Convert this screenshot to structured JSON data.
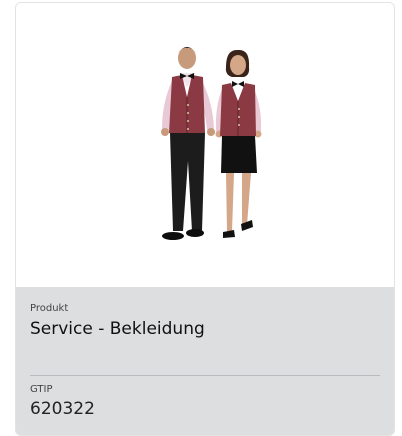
{
  "product": {
    "image_alt": "Service staff uniform: man and woman in burgundy vests",
    "category_label": "Produkt",
    "category_value": "Service - Bekleidung",
    "gtip_label": "GTIP",
    "gtip_value": "620322"
  },
  "colors": {
    "info_background": "#dddee0",
    "vest": "#8b3a44",
    "shirt": "#e9c9d6",
    "trousers": "#1c1c1c"
  }
}
